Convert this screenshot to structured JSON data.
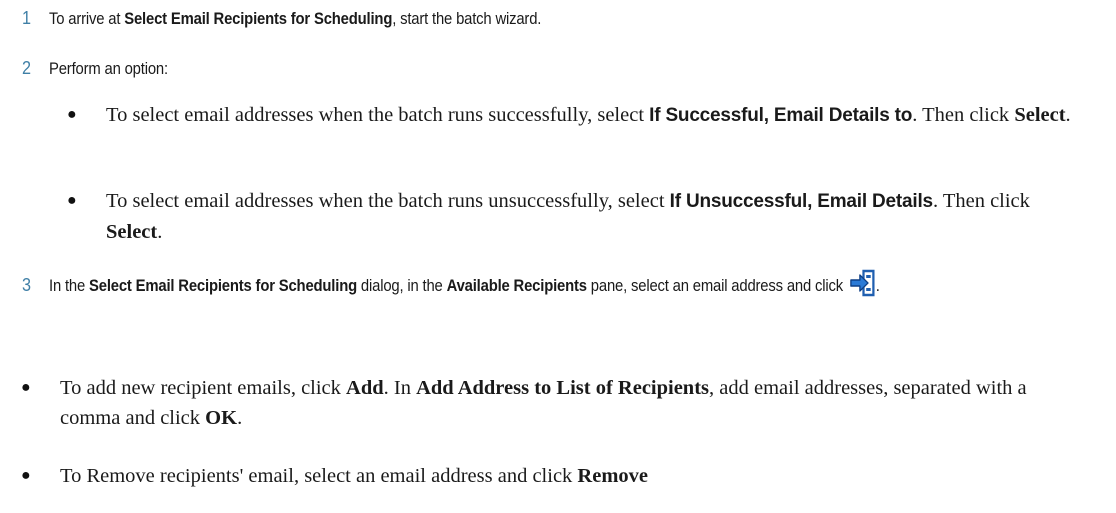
{
  "steps": [
    {
      "number": "1",
      "text_before": "To arrive at ",
      "bold": "Select Email Recipients for Scheduling",
      "text_after": ", start the batch wizard."
    },
    {
      "number": "2",
      "text": "Perform an option:"
    },
    {
      "number": "3",
      "text_a": "In the ",
      "bold_a": "Select Email Recipients for Scheduling",
      "text_b": " dialog, in the ",
      "bold_b": "Available Recipients",
      "text_c": " pane, select an email address and click ",
      "icon": "move-right-icon",
      "text_d": "."
    }
  ],
  "options": [
    {
      "text_before": "To select email addresses when the batch runs successfully, select ",
      "bold": "If Successful, Email Details to",
      "text_mid": ". Then click ",
      "button": "Select",
      "text_after": "."
    },
    {
      "text_before": "To select email addresses when the batch runs unsuccessfully, select ",
      "bold": "If Unsuccessful, Email Details",
      "text_mid": ". Then click ",
      "button": "Select",
      "text_after": "."
    }
  ],
  "notes": [
    {
      "text_a": "To add new recipient emails, click ",
      "bold_a": "Add",
      "text_b": ". In ",
      "bold_b": "Add Address to List of Recipients",
      "text_c": ", add email addresses, separated with a comma and click ",
      "bold_c": "OK",
      "text_d": "."
    },
    {
      "text_a": "To Remove recipients' email, select an email address and click ",
      "bold_a": "Remove"
    }
  ],
  "colors": {
    "step_number": "#3f7fa6",
    "icon_blue": "#1f5fb0"
  }
}
